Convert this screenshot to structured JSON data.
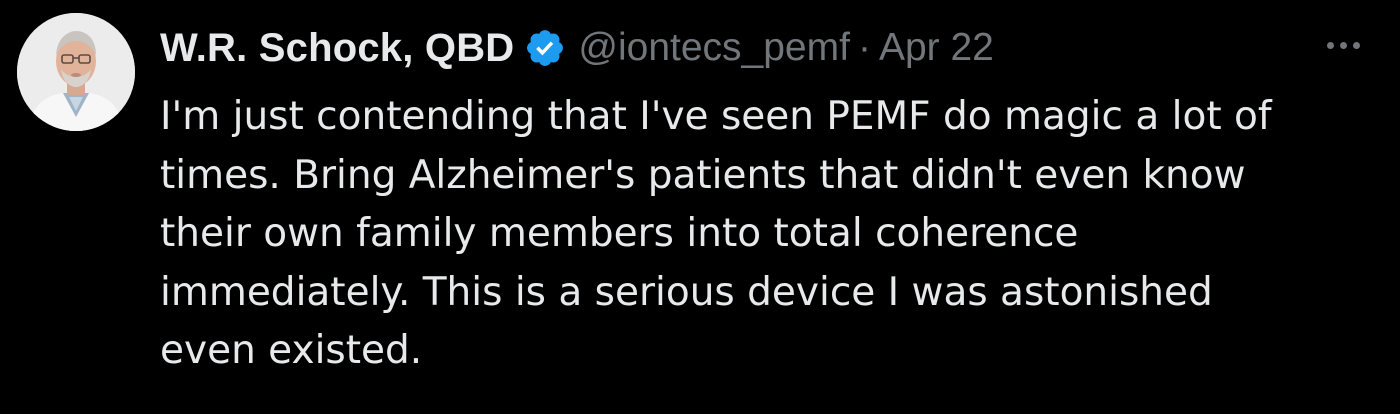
{
  "tweet": {
    "author": {
      "display_name": "W.R. Schock, QBD",
      "handle": "@iontecs_pemf",
      "verified_icon": "verified-badge-icon"
    },
    "separator": "·",
    "date": "Apr 22",
    "more_icon": "more-options-icon",
    "text_lines": [
      "I'm just contending that I've seen PEMF do magic a lot of",
      "times. Bring Alzheimer's patients that didn't even know",
      "their own family members into total coherence",
      "immediately. This is a serious device I was astonished",
      "even existed."
    ]
  },
  "colors": {
    "background": "#000000",
    "primary_text": "#e7e9ea",
    "secondary_text": "#71767b",
    "verified_blue": "#1d9bf0"
  }
}
